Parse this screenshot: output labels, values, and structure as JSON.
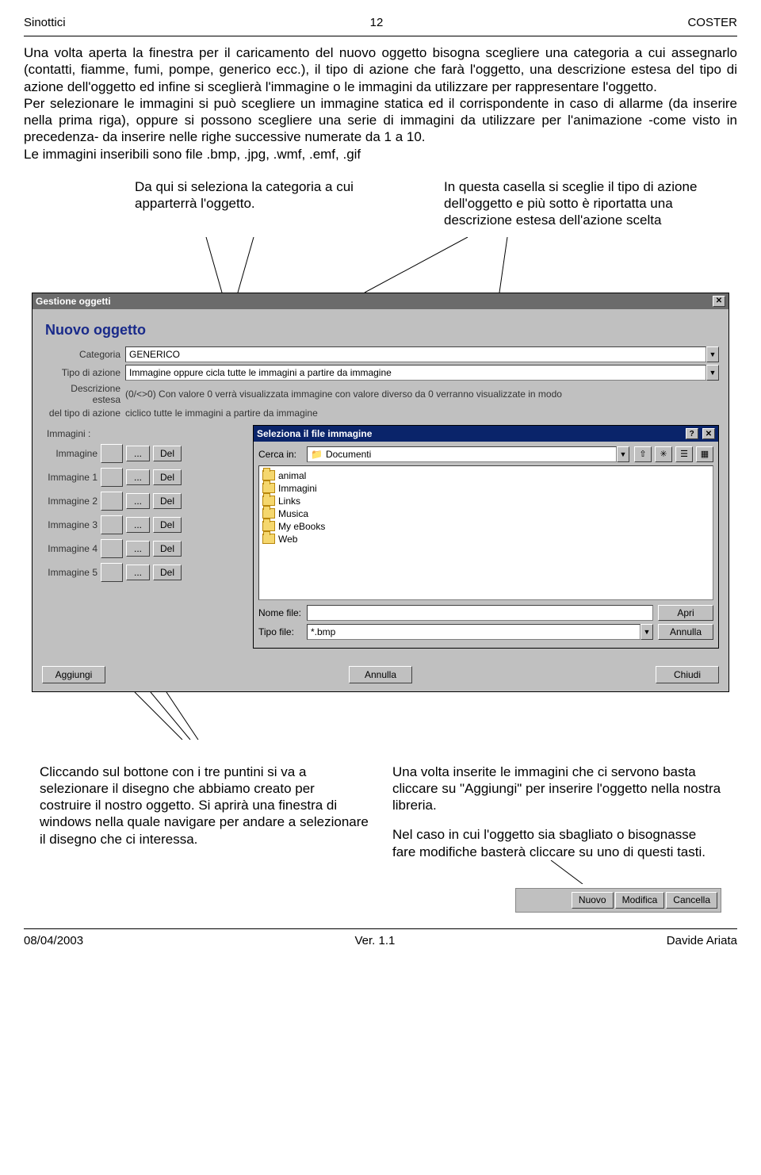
{
  "header": {
    "left": "Sinottici",
    "center": "12",
    "right": "COSTER"
  },
  "body_text": "Una volta aperta la finestra per il caricamento del nuovo oggetto bisogna scegliere una categoria a cui assegnarlo (contatti, fiamme, fumi, pompe, generico ecc.), il tipo di azione che farà l'oggetto, una descrizione estesa del tipo di azione dell'oggetto ed infine si sceglierà l'immagine o le immagini da utilizzare per rappresentare l'oggetto.\nPer selezionare le immagini si può scegliere un immagine statica ed il corrispondente in caso di allarme (da inserire nella prima riga), oppure si possono scegliere una serie di immagini da utilizzare per l'animazione -come visto in precedenza- da inserire nelle righe successive numerate da 1 a 10.\nLe immagini inseribili sono file .bmp, .jpg, .wmf, .emf, .gif",
  "callout_a": "Da qui si seleziona la categoria a cui apparterrà l'oggetto.",
  "callout_b": "In questa casella si sceglie il tipo di azione dell'oggetto e più sotto è riportatta una descrizione estesa dell'azione scelta",
  "dialog": {
    "title": "Gestione oggetti",
    "section": "Nuovo oggetto",
    "rows": {
      "categoria_lbl": "Categoria",
      "categoria_val": "GENERICO",
      "tipo_lbl": "Tipo di azione",
      "tipo_val": "Immagine oppure cicla tutte le immagini a partire da immagine",
      "desc_lbl": "Descrizione estesa",
      "desc_val": "(0/<>0) Con valore 0 verrà visualizzata immagine con valore diverso da 0 verranno visualizzate in modo",
      "desc_lbl2": "del tipo di azione",
      "desc_val2": "ciclico tutte le immagini a partire da immagine"
    },
    "images_label": "Immagini :",
    "image_rows": [
      "Immagine",
      "Immagine 1",
      "Immagine 2",
      "Immagine 3",
      "Immagine 4",
      "Immagine 5"
    ],
    "dots": "...",
    "del": "Del",
    "buttons": {
      "aggiungi": "Aggiungi",
      "annulla": "Annulla",
      "chiudi": "Chiudi"
    }
  },
  "filedlg": {
    "title": "Seleziona il file immagine",
    "cerca_lbl": "Cerca in:",
    "cerca_val": "Documenti",
    "folders": [
      "animal",
      "Immagini",
      "Links",
      "Musica",
      "My eBooks",
      "Web"
    ],
    "nome_lbl": "Nome file:",
    "nome_val": "",
    "tipo_lbl": "Tipo file:",
    "tipo_val": "*.bmp",
    "apri": "Apri",
    "annulla": "Annulla"
  },
  "callout_c": "Una volta inserite le immagini che ci servono basta cliccare su \"Aggiungi\" per inserire l'oggetto nella nostra libreria.",
  "callout_d": "Nel caso in cui l'oggetto sia sbagliato o bisognasse fare modifiche basterà cliccare su uno di questi tasti.",
  "callout_e": "Cliccando sul bottone con i tre puntini si va a selezionare il disegno che abbiamo creato per costruire il nostro oggetto. Si aprirà una finestra di windows nella quale navigare per andare a selezionare il disegno che ci interessa.",
  "small_buttons": [
    "Nuovo",
    "Modifica",
    "Cancella"
  ],
  "footer": {
    "left": "08/04/2003",
    "center": "Ver. 1.1",
    "right": "Davide Ariata"
  }
}
